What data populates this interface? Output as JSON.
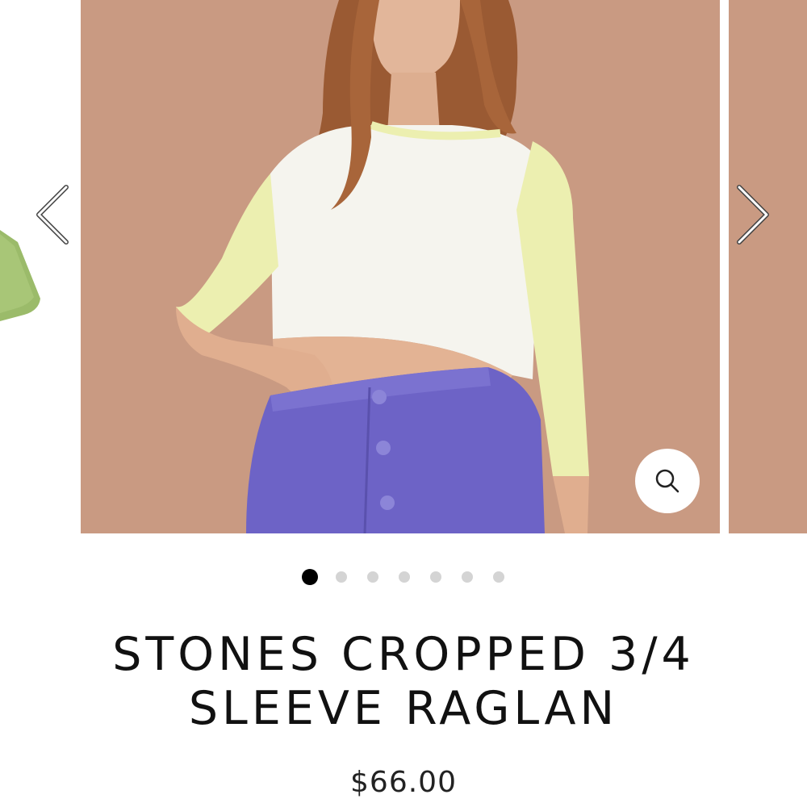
{
  "carousel": {
    "prev_image_icon": "skirt-thumbnail",
    "main_image_icon": "model-photo",
    "next_image_icon": "model-photo-next",
    "prev_arrow_icon": "chevron-left-icon",
    "next_arrow_icon": "chevron-right-icon",
    "zoom_icon": "search-icon",
    "slide_count": 7,
    "active_index": 0,
    "background_color": "#c99a82"
  },
  "product": {
    "title_line1": "STONES CROPPED 3/4",
    "title_line2": "SLEEVE RAGLAN",
    "price": "$66.00"
  },
  "colors": {
    "dot_active": "#000000",
    "dot_inactive": "#d4d4d4",
    "text": "#111111"
  }
}
